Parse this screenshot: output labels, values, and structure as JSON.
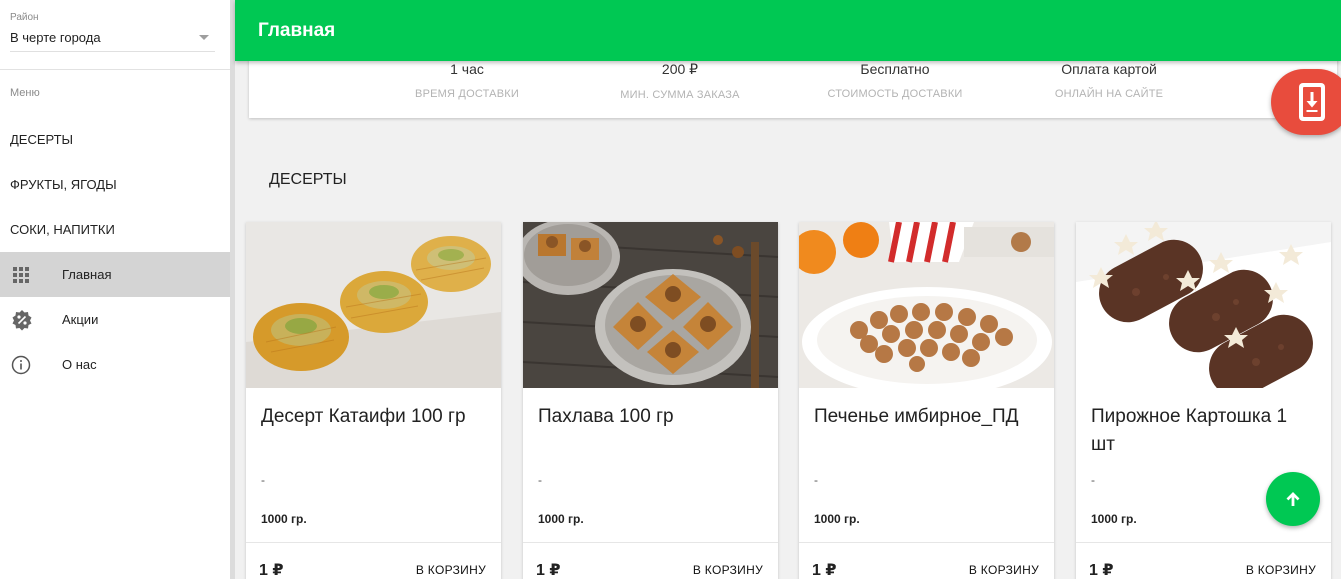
{
  "sidebar": {
    "district_label": "Район",
    "district_value": "В черте города",
    "menu_label": "Меню",
    "categories": [
      {
        "label": "ДЕСЕРТЫ"
      },
      {
        "label": "ФРУКТЫ, ЯГОДЫ"
      },
      {
        "label": "СОКИ, НАПИТКИ"
      }
    ],
    "nav": [
      {
        "label": "Главная",
        "icon": "grid-icon",
        "active": true
      },
      {
        "label": "Акции",
        "icon": "discount-badge-icon",
        "active": false
      },
      {
        "label": "О нас",
        "icon": "info-icon",
        "active": false
      }
    ]
  },
  "header": {
    "title": "Главная",
    "color": "#00c853"
  },
  "info": [
    {
      "value": "1 час",
      "caption": "ВРЕМЯ ДОСТАВКИ"
    },
    {
      "value": "200 ₽",
      "caption": "МИН. СУММА ЗАКАЗА"
    },
    {
      "value": "Бесплатно",
      "caption": "СТОИМОСТЬ ДОСТАВКИ"
    },
    {
      "value": "Оплата картой",
      "caption": "ОНЛАЙН НА САЙТЕ"
    }
  ],
  "section": {
    "title": "ДЕСЕРТЫ"
  },
  "products": [
    {
      "name": "Десерт Катаифи 100 гр",
      "desc": "-",
      "weight": "1000 гр.",
      "price": "1 ₽",
      "cart": "В КОРЗИНУ"
    },
    {
      "name": "Пахлава 100 гр",
      "desc": "-",
      "weight": "1000 гр.",
      "price": "1 ₽",
      "cart": "В КОРЗИНУ"
    },
    {
      "name": "Печенье имбирное_ПД",
      "desc": "-",
      "weight": "1000 гр.",
      "price": "1 ₽",
      "cart": "В КОРЗИНУ"
    },
    {
      "name": "Пирожное Картошка 1 шт",
      "desc": "-",
      "weight": "1000 гр.",
      "price": "1 ₽",
      "cart": "В КОРЗИНУ"
    }
  ],
  "fabs": {
    "download_color": "#e84c3d",
    "scroll_top_color": "#00c853"
  }
}
